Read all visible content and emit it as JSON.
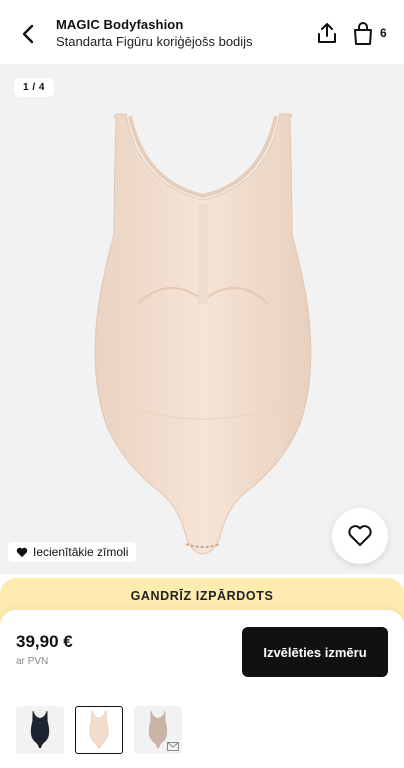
{
  "header": {
    "brand": "MAGIC Bodyfashion",
    "product_name": "Standarta Figūru koriģējošs bodijs",
    "bag_count": "6"
  },
  "gallery": {
    "counter": "1 / 4",
    "favorite_badge": "Iecienītākie zīmoli",
    "product_color": "#f2dccb"
  },
  "sheet": {
    "banner": "GANDRĪZ IZPĀRDOTS",
    "price": "39,90 €",
    "vat_note": "ar PVN",
    "cta_label": "Izvēlēties izmēru"
  },
  "thumbnails": [
    {
      "color": "#1d2430",
      "selected": false
    },
    {
      "color": "#f2dccb",
      "selected": true
    },
    {
      "color": "#c9b2a6",
      "selected": false
    }
  ],
  "colors": {
    "banner": "#fdebb0",
    "cta": "#111111"
  }
}
